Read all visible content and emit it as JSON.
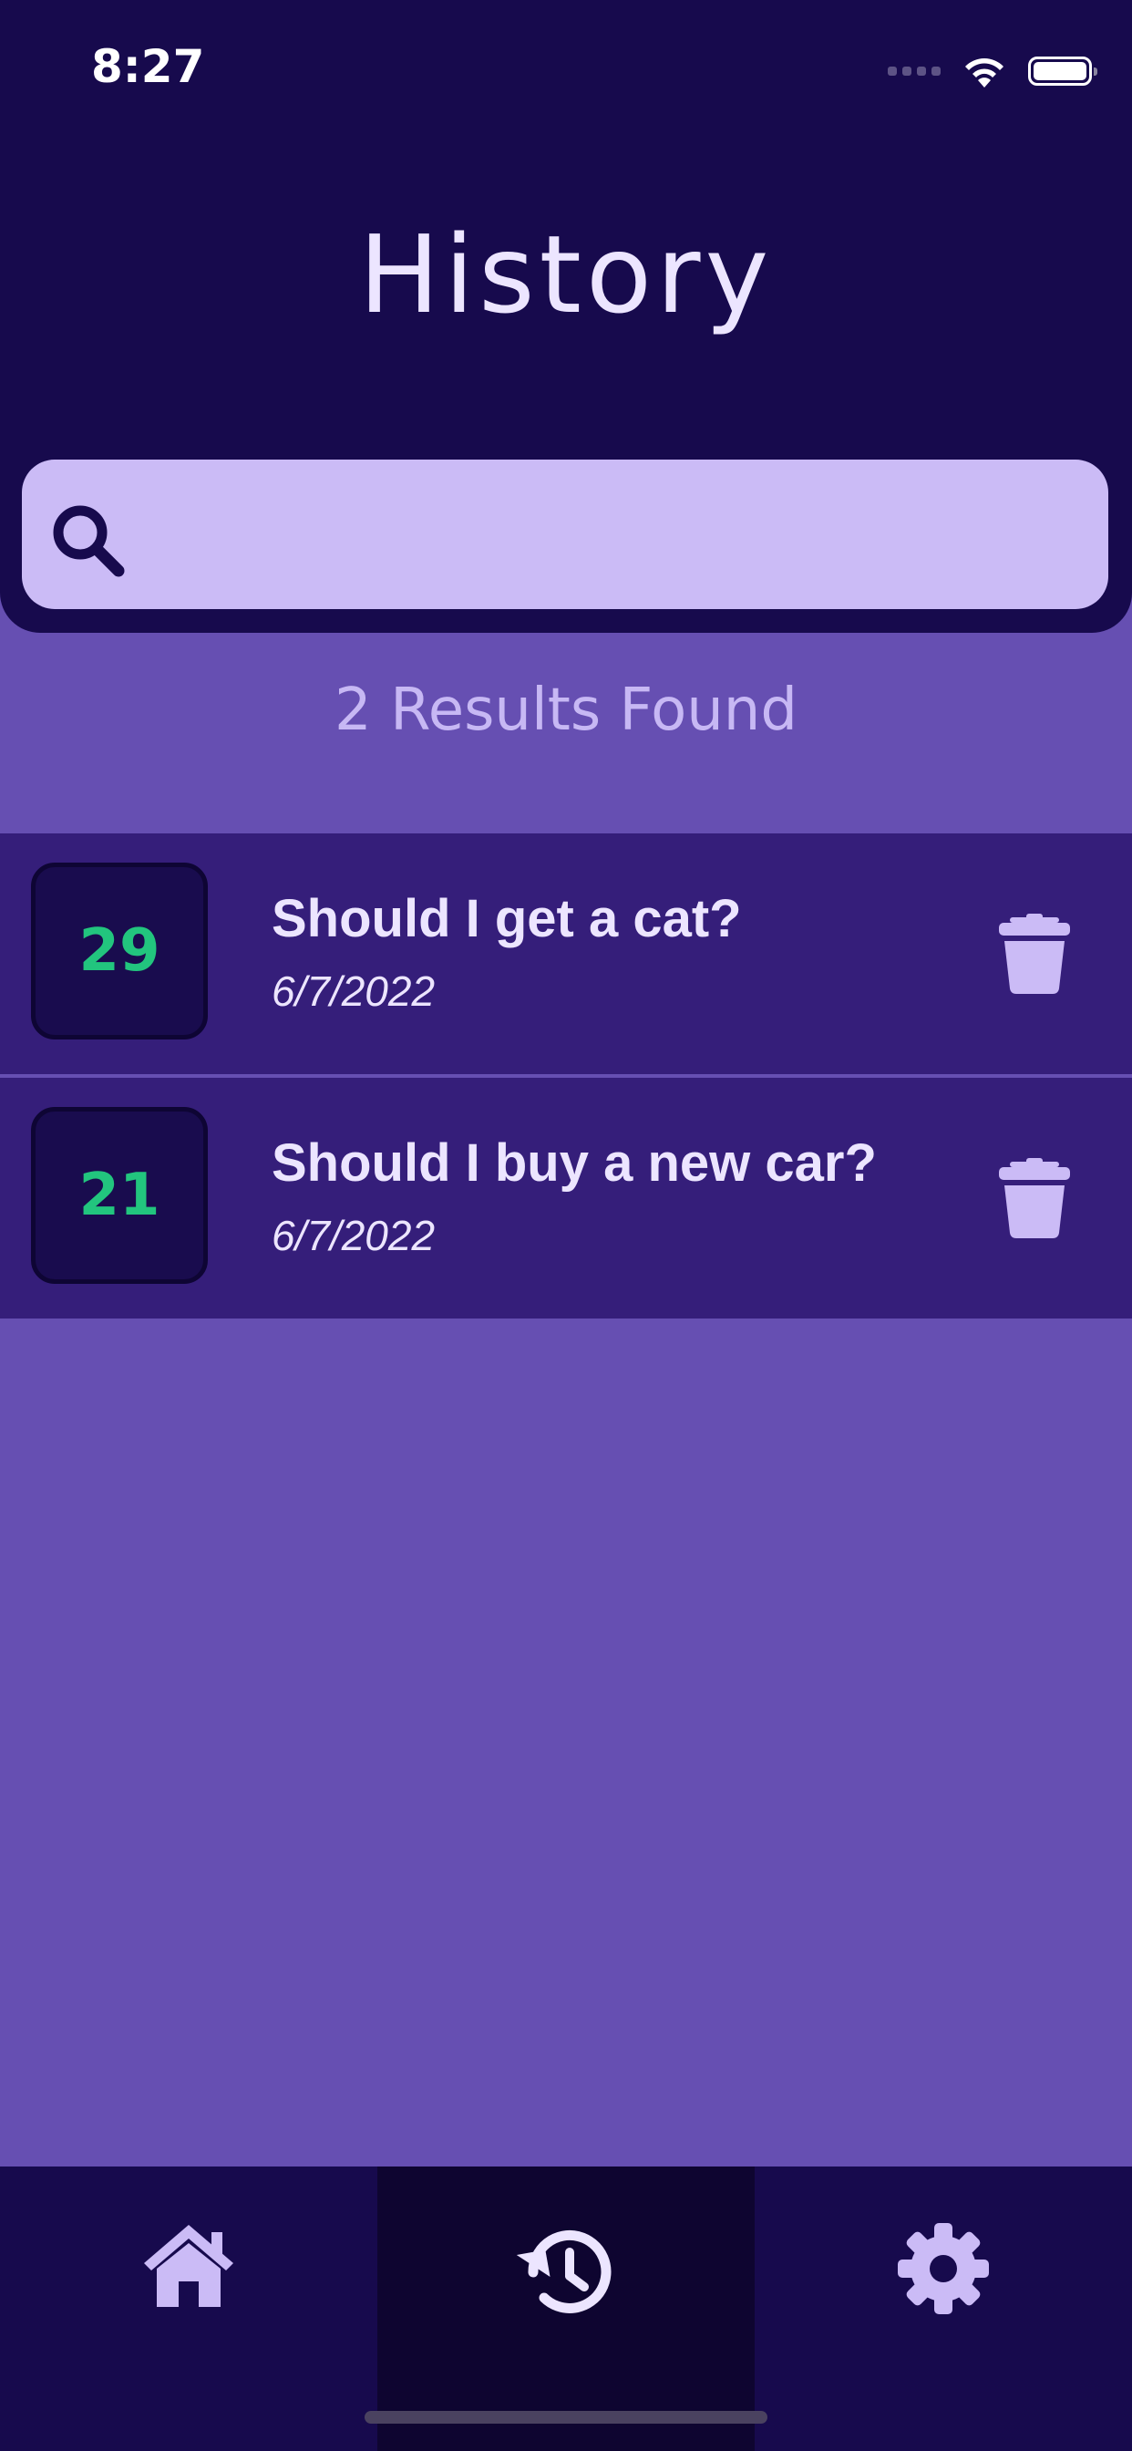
{
  "status_bar": {
    "time": "8:27"
  },
  "header": {
    "title": "History"
  },
  "search": {
    "placeholder": "",
    "value": ""
  },
  "results": {
    "count_text": "2 Results Found"
  },
  "history_items": [
    {
      "score": "29",
      "title": "Should I get a cat?",
      "date": "6/7/2022"
    },
    {
      "score": "21",
      "title": "Should I buy a new car?",
      "date": "6/7/2022"
    }
  ],
  "tabbar": {
    "tabs": [
      {
        "icon": "home-icon",
        "active": false
      },
      {
        "icon": "history-icon",
        "active": true
      },
      {
        "icon": "gear-icon",
        "active": false
      }
    ]
  },
  "colors": {
    "header_bg": "#170a4d",
    "page_bg": "#664fb2",
    "row_bg": "#351e7a",
    "search_bg": "#cbbbf6",
    "score_green": "#22c57e",
    "text_light": "#ece5ff"
  }
}
